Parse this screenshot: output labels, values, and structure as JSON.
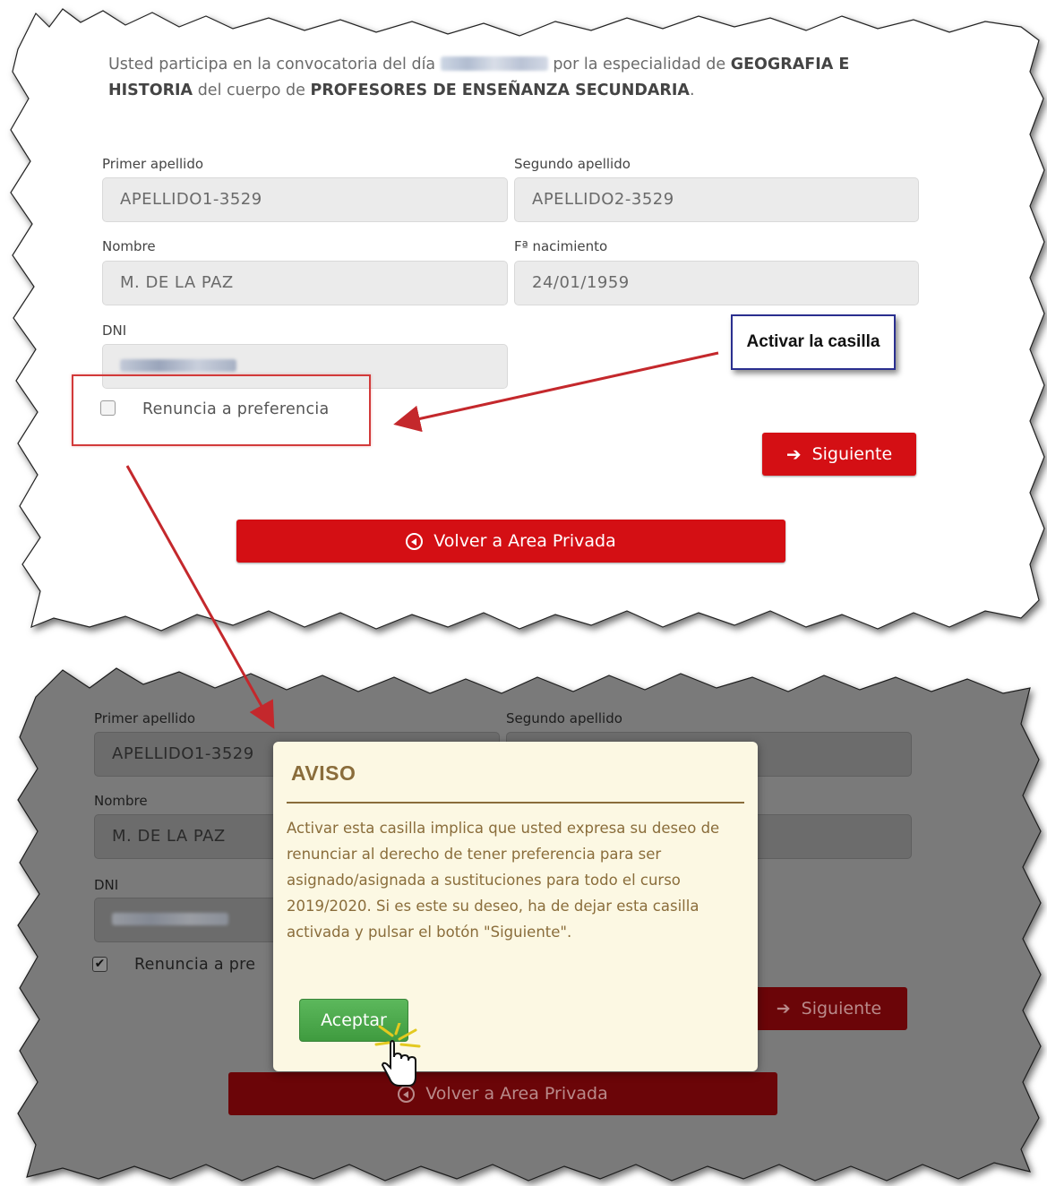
{
  "intro": {
    "prefix": "Usted participa en la convocatoria del día",
    "middle": "por la especialidad de",
    "specialty": "GEOGRAFIA E HISTORIA",
    "body_text": "del cuerpo de",
    "body": "PROFESORES DE ENSEÑANZA SECUNDARIA",
    "suffix": "."
  },
  "form": {
    "primer_apellido_label": "Primer apellido",
    "primer_apellido_value": "APELLIDO1-3529",
    "segundo_apellido_label": "Segundo apellido",
    "segundo_apellido_value": "APELLIDO2-3529",
    "nombre_label": "Nombre",
    "nombre_value": "M. DE LA PAZ",
    "nacimiento_label": "Fª nacimiento",
    "nacimiento_value": "24/01/1959",
    "dni_label": "DNI",
    "renuncia_label": "Renuncia a preferencia",
    "siguiente_label": "Siguiente",
    "volver_label": "Volver a Area Privada"
  },
  "annotation": {
    "callout_text": "Activar la casilla"
  },
  "bottom": {
    "renuncia_label": "Renuncia a pre",
    "checkbox_checked": true
  },
  "modal": {
    "title": "AVISO",
    "message": "Activar esta casilla implica que usted expresa su deseo de renunciar al derecho de tener preferencia para ser asignado/asignada a sustituciones para todo el curso 2019/2020. Si es este su deseo, ha de dejar esta casilla activada y pulsar el botón \"Siguiente\".",
    "accept_label": "Aceptar"
  },
  "colors": {
    "primary_red": "#d40f14",
    "annotation_red": "#d23a3a",
    "callout_border": "#2a2f8f",
    "modal_bg": "#fcf8e3",
    "modal_text": "#8a6d3b",
    "accept_green": "#5cb85c"
  },
  "icons": [
    "arrow-right-icon",
    "circle-arrow-left-icon",
    "checkbox-icon",
    "hand-pointer-icon"
  ]
}
